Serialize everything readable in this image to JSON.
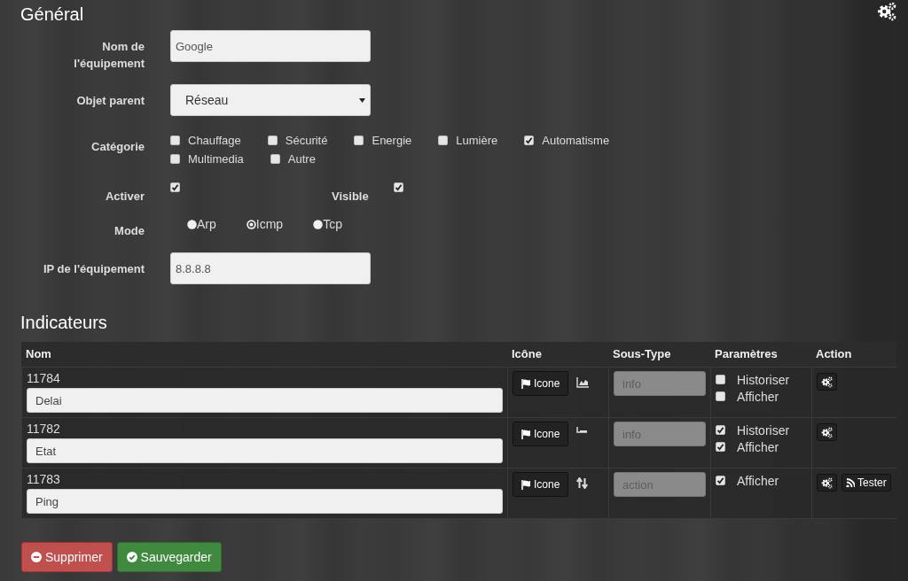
{
  "general": {
    "title": "Général",
    "name_field": {
      "label": "Nom de l'équipement",
      "value": "Google"
    },
    "parent_field": {
      "label": "Objet parent",
      "value": "Réseau"
    },
    "category": {
      "label": "Catégorie",
      "options": [
        {
          "label": "Chauffage",
          "checked": false
        },
        {
          "label": "Sécurité",
          "checked": false
        },
        {
          "label": "Energie",
          "checked": false
        },
        {
          "label": "Lumière",
          "checked": false
        },
        {
          "label": "Automatisme",
          "checked": true
        },
        {
          "label": "Multimedia",
          "checked": false
        },
        {
          "label": "Autre",
          "checked": false
        }
      ]
    },
    "activate": {
      "label": "Activer",
      "checked": true
    },
    "visible": {
      "label": "Visible",
      "checked": true
    },
    "mode": {
      "label": "Mode",
      "options": [
        {
          "label": "Arp",
          "selected": false
        },
        {
          "label": "Icmp",
          "selected": true
        },
        {
          "label": "Tcp",
          "selected": false
        }
      ]
    },
    "ip_field": {
      "label": "IP de l'équipement",
      "value": "8.8.8.8"
    }
  },
  "indicators": {
    "title": "Indicateurs",
    "columns": [
      "Nom",
      "Icône",
      "Sous-Type",
      "Paramètres",
      "Action"
    ],
    "rows": [
      {
        "id": "11784",
        "name": "Delai",
        "icon_button": "Icone",
        "subtype": {
          "value": "info",
          "disabled": true
        },
        "params": [
          {
            "label": "Historiser",
            "checked": false
          },
          {
            "label": "Afficher",
            "checked": false
          }
        ],
        "actions": [
          {
            "kind": "gear"
          }
        ]
      },
      {
        "id": "11782",
        "name": "Etat",
        "icon_button": "Icone",
        "subtype": {
          "value": "info",
          "disabled": true
        },
        "params": [
          {
            "label": "Historiser",
            "checked": true
          },
          {
            "label": "Afficher",
            "checked": true
          }
        ],
        "actions": [
          {
            "kind": "gear"
          }
        ]
      },
      {
        "id": "11783",
        "name": "Ping",
        "icon_button": "Icone",
        "subtype": {
          "value": "action",
          "disabled": true
        },
        "params": [
          {
            "label": "Afficher",
            "checked": true
          }
        ],
        "actions": [
          {
            "kind": "gear"
          },
          {
            "kind": "test",
            "label": "Tester"
          }
        ]
      }
    ]
  },
  "buttons": [
    {
      "kind": "danger",
      "label": "Supprimer"
    },
    {
      "kind": "success",
      "label": "Sauvegarder"
    }
  ]
}
